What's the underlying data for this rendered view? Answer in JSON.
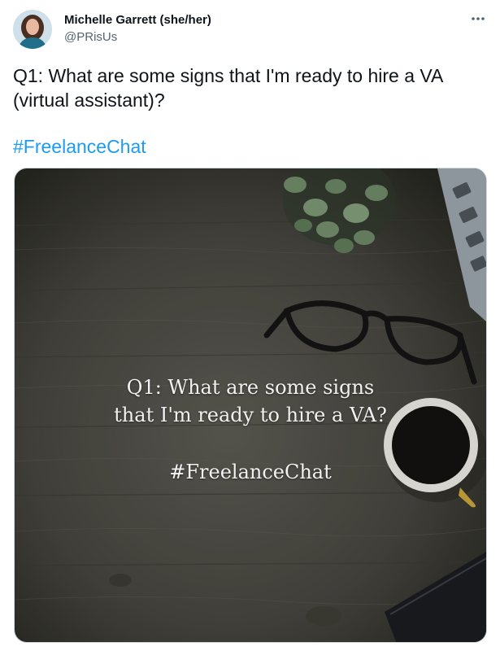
{
  "author": {
    "display_name": "Michelle Garrett (she/her)",
    "handle": "@PRisUs",
    "avatar_icon": "profile-photo"
  },
  "header": {
    "more_icon": "more-horizontal-icon"
  },
  "tweet": {
    "text": "Q1: What are some signs that I'm ready to hire a VA (virtual assistant)?",
    "hashtag": "#FreelanceChat"
  },
  "media": {
    "overlay_line1": "Q1: What are some signs",
    "overlay_line2": "that I'm ready to hire a VA?",
    "overlay_hashtag": "#FreelanceChat",
    "depicts": [
      "wood-desk",
      "plant",
      "eyeglasses",
      "coffee-cup",
      "laptop",
      "phone"
    ]
  },
  "colors": {
    "text_primary": "#0f1419",
    "text_secondary": "#536471",
    "link": "#1d9bf0",
    "desk": "#4a4a42"
  }
}
